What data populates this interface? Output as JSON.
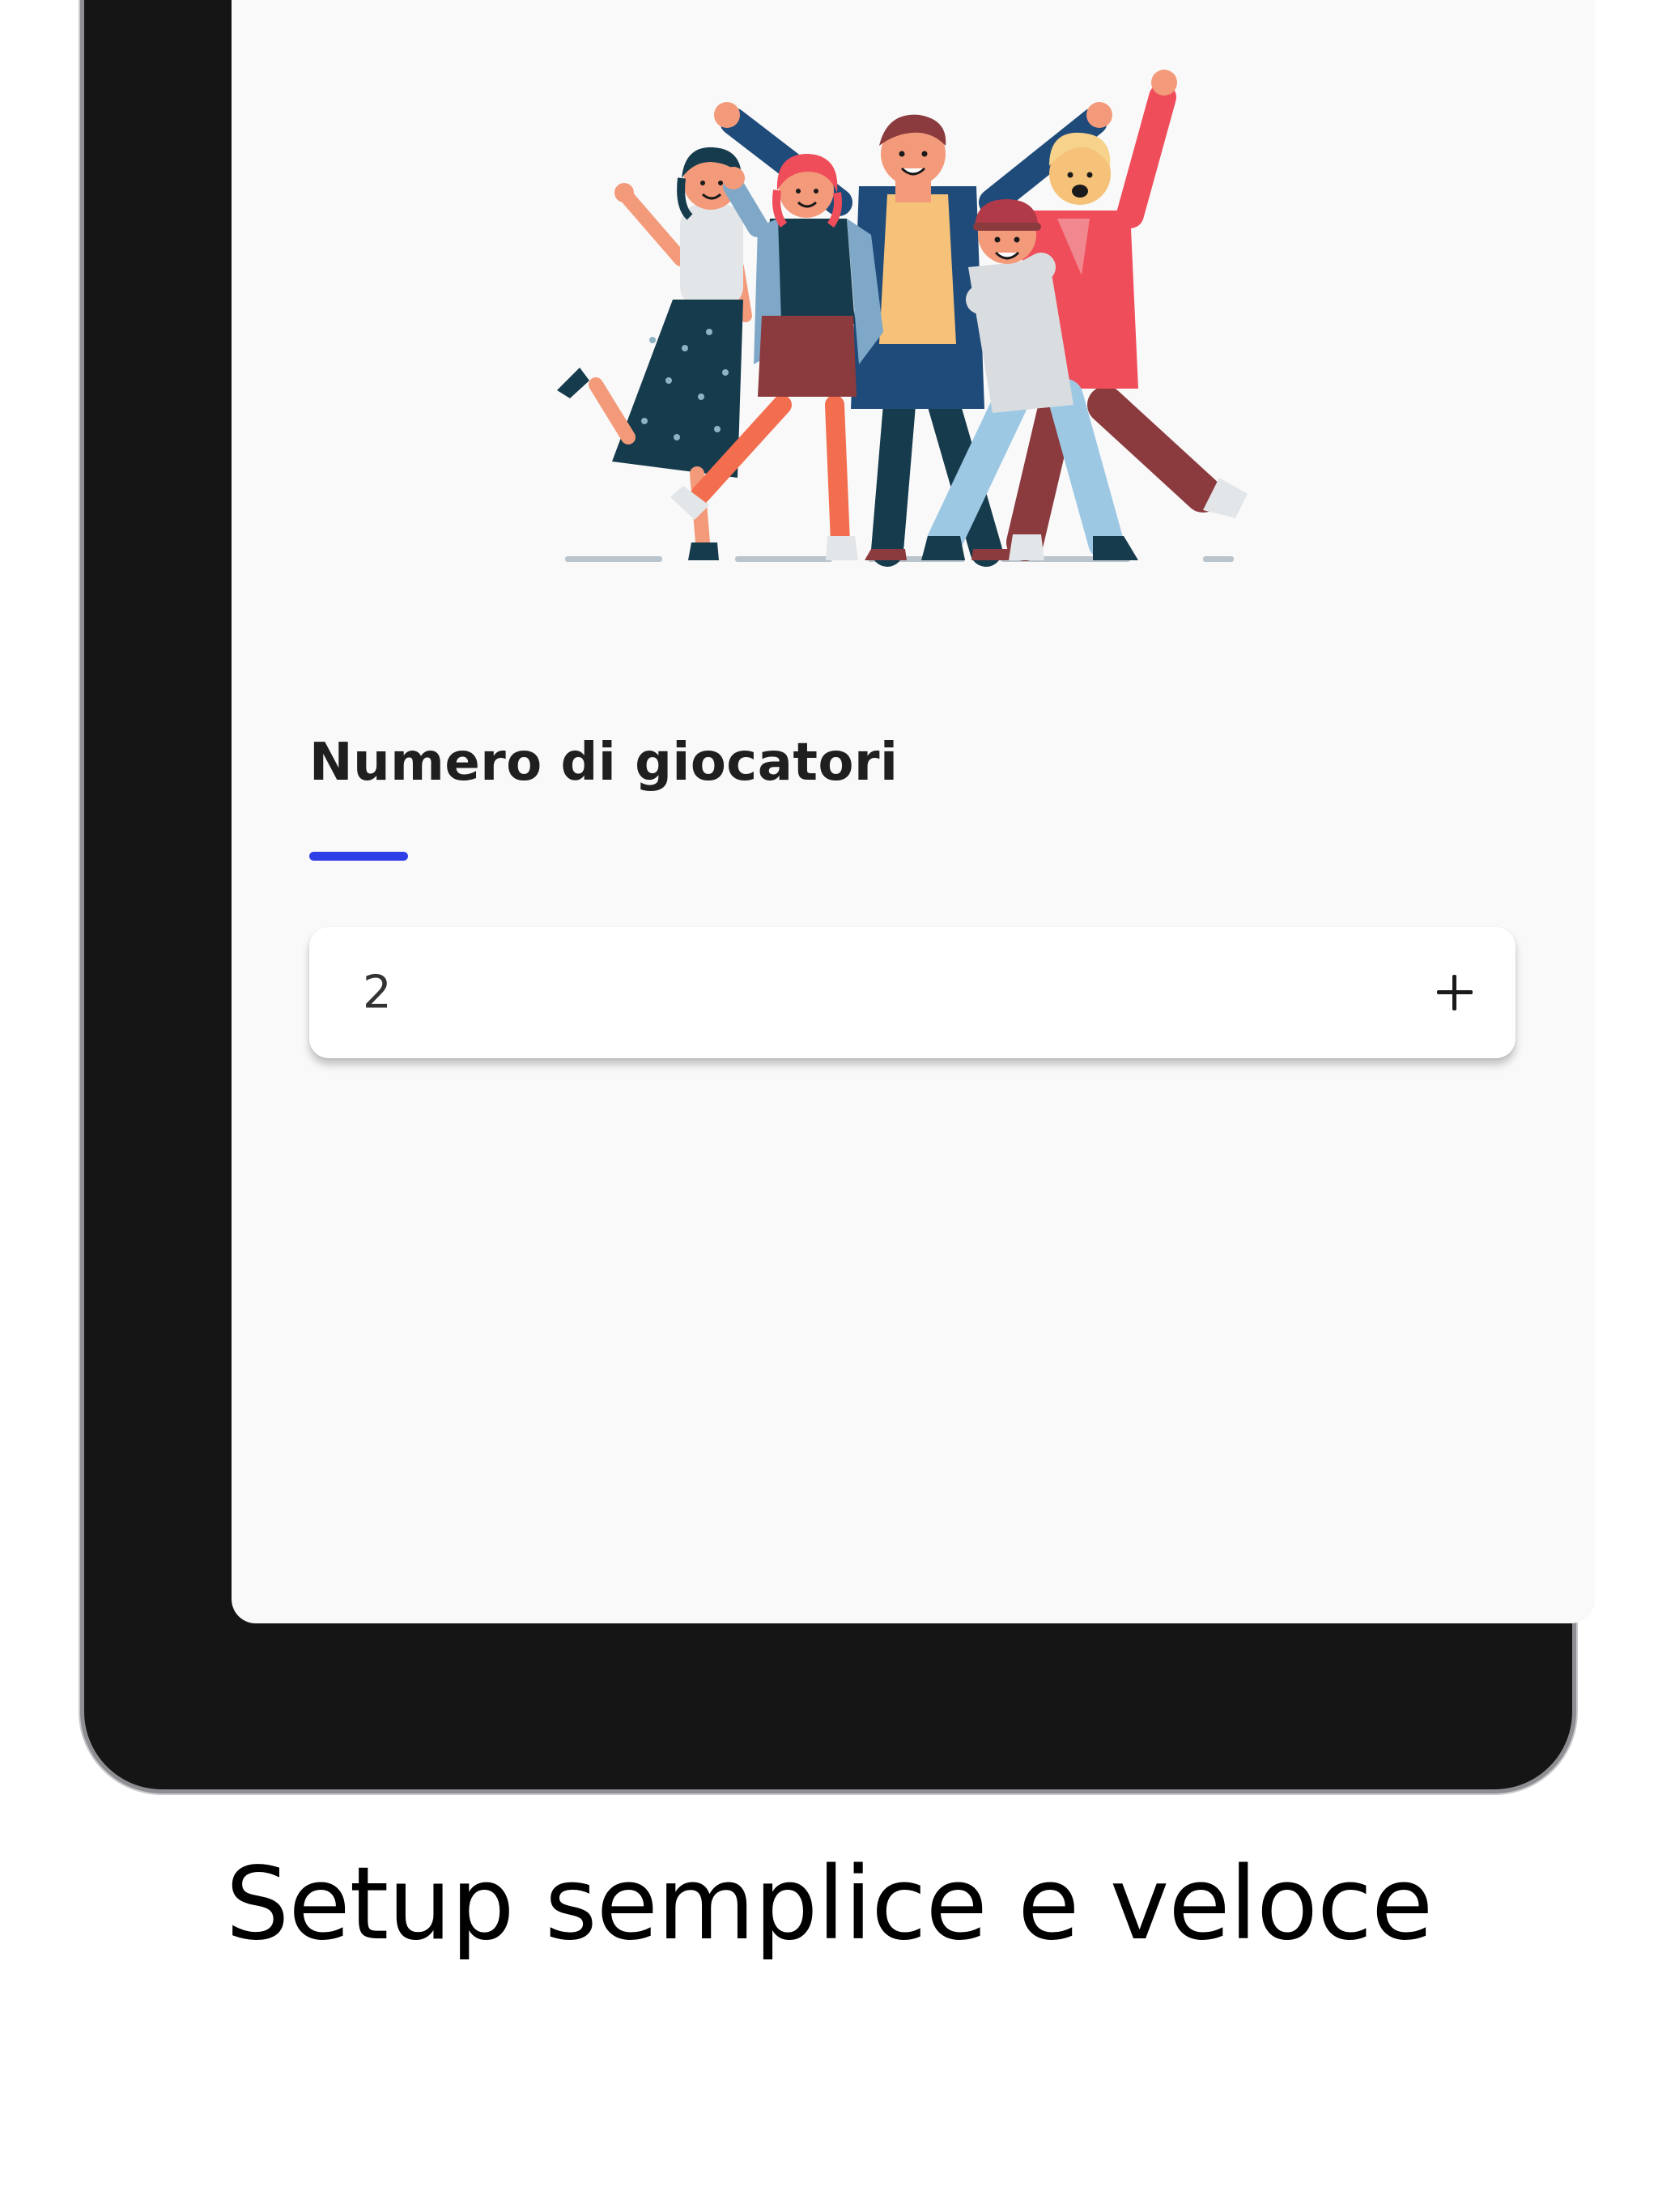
{
  "screen": {
    "illustration_name": "group-of-friends-illustration",
    "section_title": "Numero di giocatori",
    "accent_color": "#2f3fe6",
    "stepper": {
      "value": "2",
      "increment_icon": "plus-icon"
    }
  },
  "caption": "Setup semplice e veloce"
}
